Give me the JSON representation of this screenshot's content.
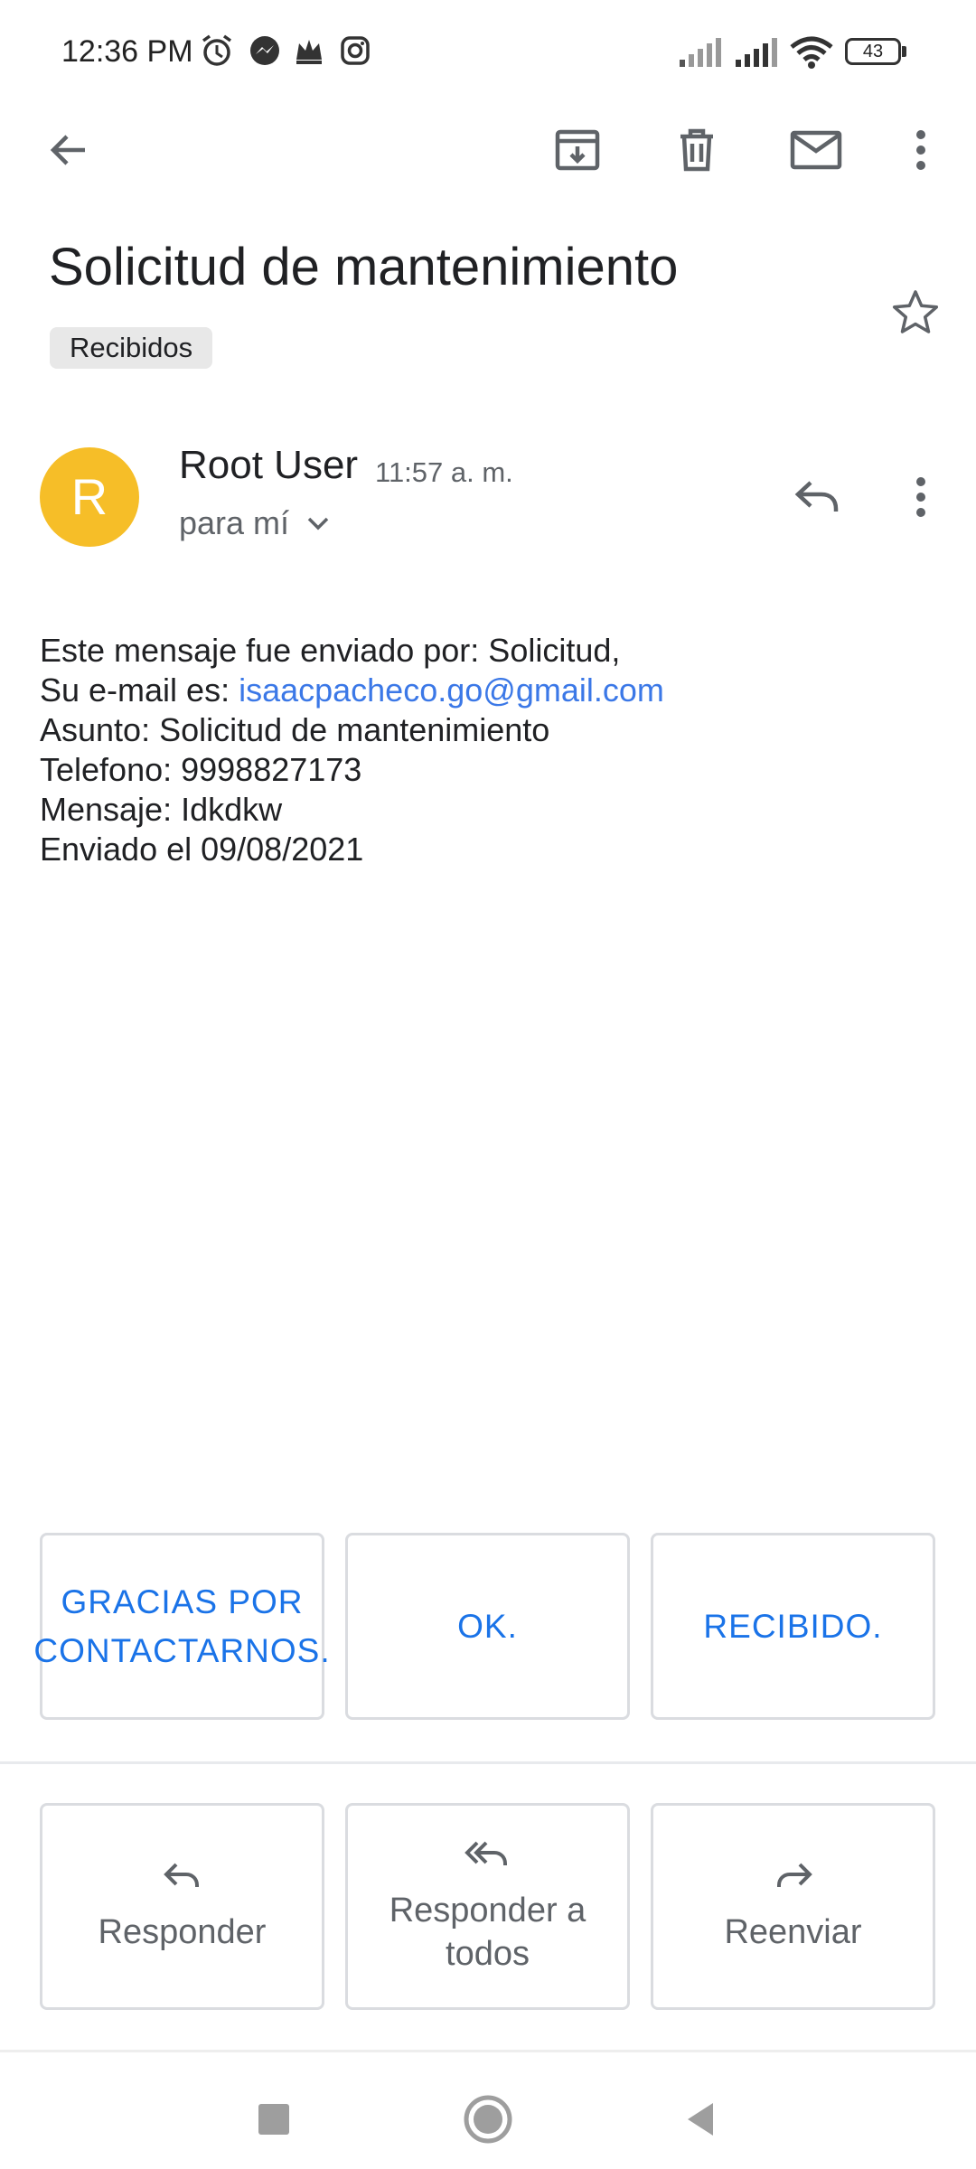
{
  "status_bar": {
    "time": "12:36 PM",
    "icons": [
      "alarm-icon",
      "messenger-icon",
      "crown-icon",
      "instagram-icon",
      "signal-icon",
      "signal-icon",
      "wifi-icon"
    ],
    "battery": "43"
  },
  "toolbar": {
    "actions": [
      "back-arrow-icon",
      "archive-icon",
      "delete-icon",
      "mark-unread-icon",
      "more-vert-icon"
    ]
  },
  "email": {
    "subject": "Solicitud de mantenimiento",
    "label": "Recibidos",
    "sender_initial": "R",
    "sender_name": "Root User",
    "time": "11:57 a. m.",
    "recipient": "para mí",
    "body": {
      "line1": "Este mensaje fue enviado por: Solicitud,",
      "line2_prefix": "Su e-mail es: ",
      "line2_link": "isaacpacheco.go@gmail.com",
      "line3": "Asunto: Solicitud de mantenimiento",
      "line4": "Telefono: 9998827173",
      "line5": "Mensaje: Idkdkw",
      "line6": "Enviado el 09/08/2021"
    }
  },
  "smart_replies": [
    "GRACIAS POR CONTACTARNOS.",
    "OK.",
    "RECIBIDO."
  ],
  "actions": {
    "reply": "Responder",
    "reply_all": "Responder a todos",
    "forward": "Reenviar"
  },
  "colors": {
    "avatar": "#f6be28",
    "link": "#3b78e7",
    "smart_reply_text": "#1a73e8"
  }
}
